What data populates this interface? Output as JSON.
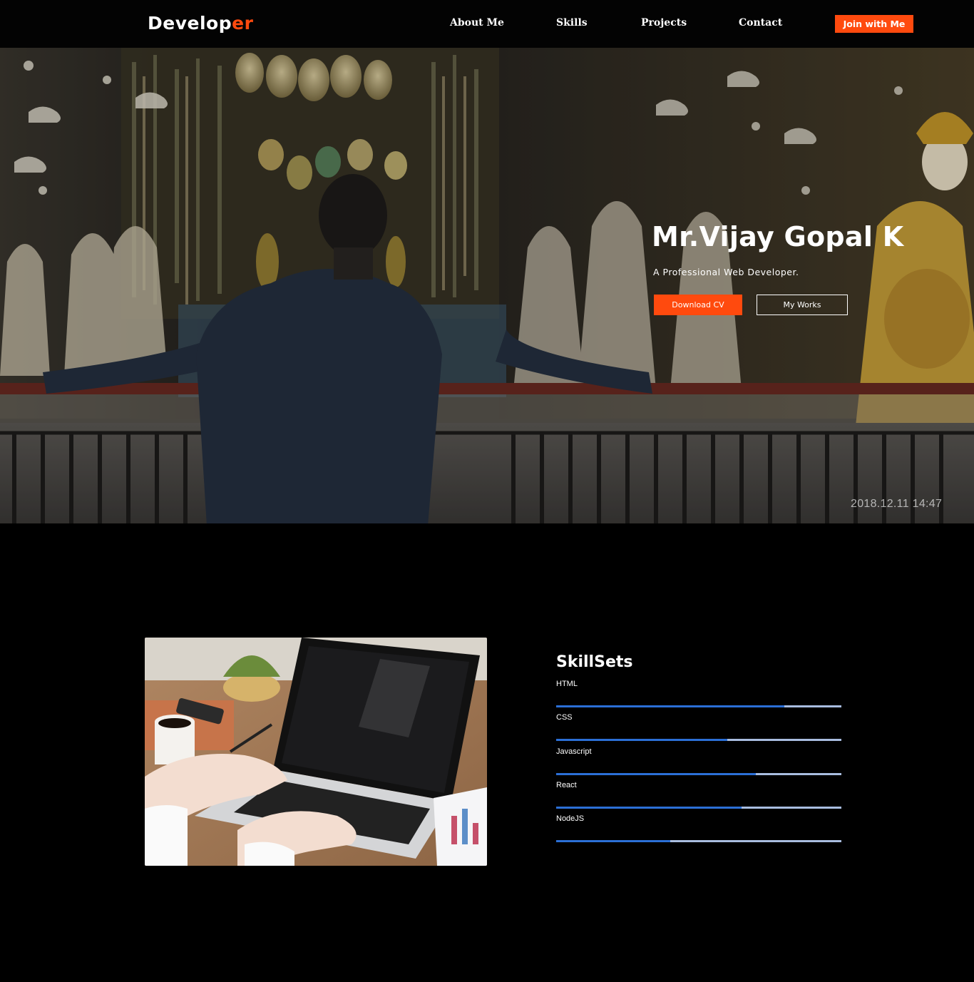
{
  "nav": {
    "logo_main": "Develop",
    "logo_accent": "er",
    "links": [
      "About Me",
      "Skills",
      "Projects",
      "Contact"
    ],
    "cta": "Join with Me"
  },
  "hero": {
    "title": "Mr.Vijay Gopal K",
    "subtitle": "A Professional Web Developer.",
    "primary_button": "Download CV",
    "secondary_button": "My Works",
    "photo_timestamp": "2018.12.11 14:47"
  },
  "skills": {
    "title": "SkillSets",
    "items": [
      {
        "name": "HTML",
        "level": 0.8
      },
      {
        "name": "CSS",
        "level": 0.6
      },
      {
        "name": "Javascript",
        "level": 0.7
      },
      {
        "name": "React",
        "level": 0.65
      },
      {
        "name": "NodeJS",
        "level": 0.4
      }
    ]
  },
  "colors": {
    "accent": "#ff4a0e",
    "skill_fill": "#2b6fd6",
    "skill_track": "#a9bde0",
    "background": "#000000"
  }
}
